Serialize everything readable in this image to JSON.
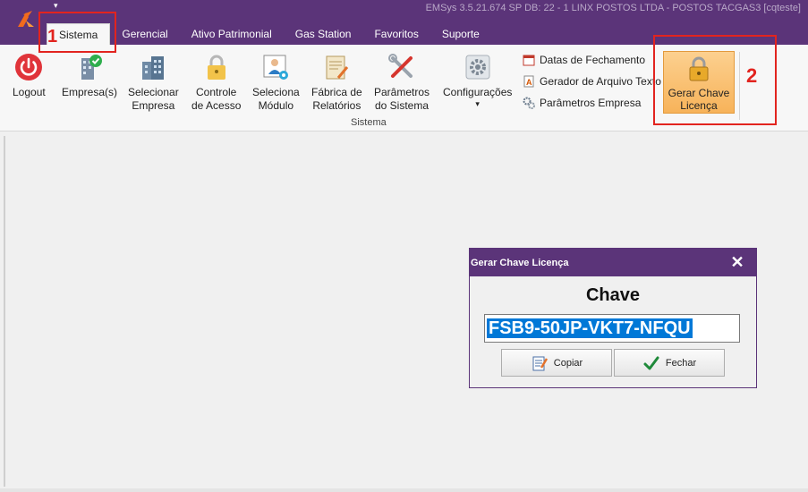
{
  "window": {
    "title": "EMSys 3.5.21.674 SP DB: 22 - 1 LINX POSTOS LTDA - POSTOS TACGAS3 [cqteste]",
    "qat_glyph": "▾"
  },
  "tabs": [
    "Sistema",
    "Gerencial",
    "Ativo Patrimonial",
    "Gas Station",
    "Favoritos",
    "Suporte"
  ],
  "ribbon": {
    "group_label": "Sistema",
    "buttons": [
      {
        "label": "Logout",
        "icon": "power-icon"
      },
      {
        "label": "Empresa(s)",
        "icon": "building-check-icon"
      },
      {
        "label": "Selecionar\nEmpresa",
        "icon": "building-icon"
      },
      {
        "label": "Controle\nde Acesso",
        "icon": "padlock-icon"
      },
      {
        "label": "Seleciona\nMódulo",
        "icon": "user-module-icon"
      },
      {
        "label": "Fábrica de\nRelatórios",
        "icon": "report-icon"
      },
      {
        "label": "Parâmetros\ndo Sistema",
        "icon": "tools-icon"
      },
      {
        "label": "Configurações",
        "icon": "gear-icon",
        "dropdown": "▾"
      }
    ],
    "small_buttons": [
      {
        "label": "Datas de Fechamento",
        "icon": "calendar-icon"
      },
      {
        "label": "Gerador de Arquivo Texto",
        "icon": "text-file-icon"
      },
      {
        "label": "Parâmetros Empresa",
        "icon": "gears-icon"
      }
    ],
    "highlight_button": {
      "label": "Gerar Chave\nLicença",
      "icon": "padlock-gold-icon"
    }
  },
  "annotations": {
    "step1": "1",
    "step2": "2",
    "color": "#e2241f"
  },
  "dialog": {
    "title": "Gerar Chave Licença",
    "close_glyph": "✕",
    "heading": "Chave",
    "key_value": "FSB9-50JP-VKT7-NFQU",
    "copy_label": "Copiar",
    "close_label": "Fechar"
  },
  "colors": {
    "title_bar": "#5b3479",
    "accent_orange": "#f7b35a",
    "selection": "#0078d7"
  }
}
